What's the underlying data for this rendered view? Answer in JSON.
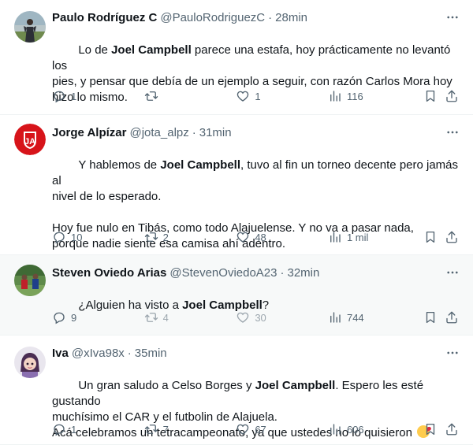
{
  "tweets": [
    {
      "name": "Paulo Rodríguez C",
      "handle": "@PauloRodriguezC",
      "dot": "·",
      "time": "28min",
      "text_segments": [
        {
          "t": "Lo de ",
          "b": false
        },
        {
          "t": "Joel Campbell",
          "b": true
        },
        {
          "t": " parece una estafa, hoy prácticamente no levantó los\npies, y pensar que debía de un ejemplo a seguir, con razón Carlos Mora hoy\nhizo lo mismo.",
          "b": false
        }
      ],
      "replies": "1",
      "retweets": "",
      "likes": "1",
      "views": "116"
    },
    {
      "name": "Jorge Alpízar",
      "handle": "@jota_alpz",
      "dot": "·",
      "time": "31min",
      "text_segments": [
        {
          "t": "Y hablemos de ",
          "b": false
        },
        {
          "t": "Joel Campbell",
          "b": true
        },
        {
          "t": ", tuvo al fin un torneo decente pero jamás al\nnivel de lo esperado.\n\nHoy fue nulo en Tibás, como todo Alajuelense. Y no va a pasar nada,\nporque nadie siente esa camisa ahí adentro.",
          "b": false
        }
      ],
      "replies": "10",
      "retweets": "2",
      "likes": "48",
      "views": "1 mil"
    },
    {
      "name": "Steven Oviedo Arias",
      "handle": "@StevenOviedoA23",
      "dot": "·",
      "time": "32min",
      "text_segments": [
        {
          "t": "¿Alguien ha visto a ",
          "b": false
        },
        {
          "t": "Joel Campbell",
          "b": true
        },
        {
          "t": "?",
          "b": false
        }
      ],
      "replies": "9",
      "retweets": "4",
      "likes": "30",
      "views": "744"
    },
    {
      "name": "Iva",
      "handle": "@xIva98x",
      "dot": "·",
      "time": "35min",
      "text_segments": [
        {
          "t": "Un gran saludo a Celso Borges y ",
          "b": false
        },
        {
          "t": "Joel Campbell",
          "b": true
        },
        {
          "t": ". Espero les esté gustando\nmuchísimo el CAR y el futbolin de Alajuela.\nAcá celebramos un tetracampeonato, ya que ustedes no lo quisieron ",
          "b": false
        }
      ],
      "emoji": "face-blowing-kiss-emoji",
      "replies": "1",
      "retweets": "7",
      "likes": "67",
      "views": "606"
    }
  ],
  "icons": [
    "more-icon",
    "reply-icon",
    "retweet-icon",
    "like-icon",
    "views-icon",
    "bookmark-icon",
    "share-icon"
  ],
  "colors": {
    "text": "#0f1419",
    "secondary": "#536471",
    "border": "#eff3f4",
    "hover_bg": "#f7f9f9",
    "avatar_red": "#d7141a"
  }
}
